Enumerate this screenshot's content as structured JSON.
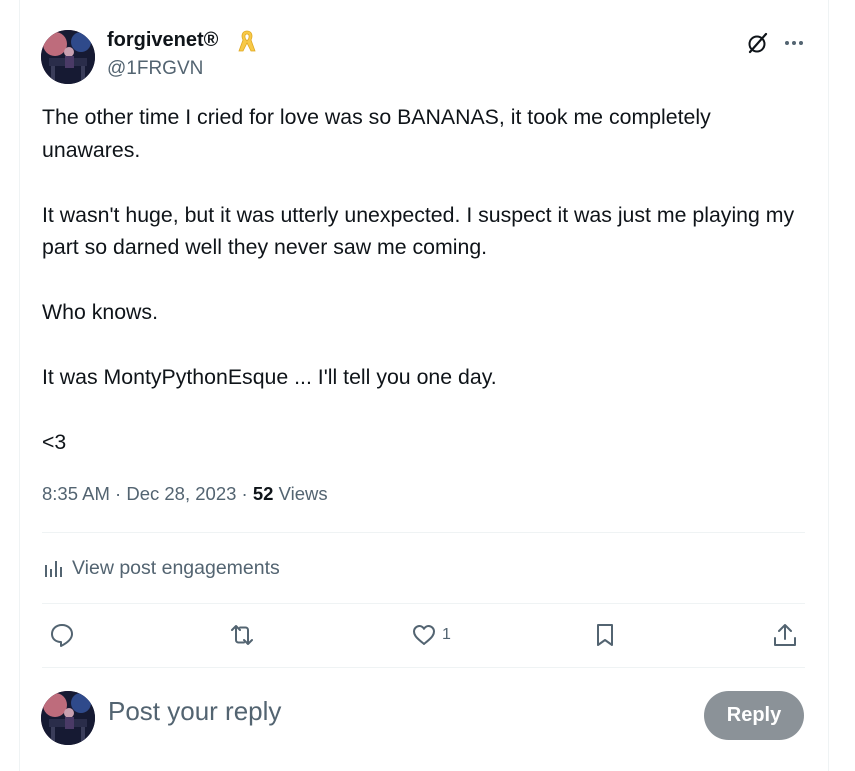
{
  "author": {
    "display_name": "forgivenet®",
    "handle": "@1FRGVN",
    "badge_icon": "yellow-ribbon-icon",
    "badge_color": "#f7c948"
  },
  "header_actions": {
    "grok_icon": "grok-icon",
    "more_icon": "more-icon"
  },
  "tweet": {
    "paragraphs": [
      "The other time I cried for love was so BANANAS, it took me completely unawares.",
      "It wasn't huge, but it was utterly unexpected. I suspect it was just me playing my part so darned well they never saw me coming.",
      "Who knows.",
      "It was MontyPythonEsque ... I'll tell you one day.",
      "<3"
    ]
  },
  "meta": {
    "time": "8:35 AM",
    "separator": "·",
    "date": "Dec 28, 2023",
    "views_count": "52",
    "views_label": "Views"
  },
  "engagements": {
    "label": "View post engagements",
    "icon": "analytics-icon"
  },
  "actions": {
    "reply_icon": "reply-icon",
    "repost_icon": "repost-icon",
    "like_icon": "heart-icon",
    "like_count": "1",
    "bookmark_icon": "bookmark-icon",
    "share_icon": "share-icon"
  },
  "reply": {
    "placeholder": "Post your reply",
    "button_label": "Reply",
    "button_color": "#8b9298"
  },
  "colors": {
    "text_primary": "#0f1419",
    "text_secondary": "#536471",
    "divider": "#eff3f4"
  }
}
